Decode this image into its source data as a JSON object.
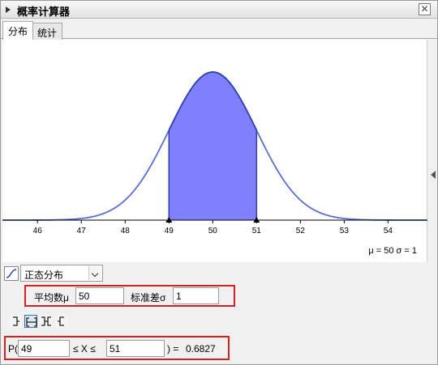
{
  "window": {
    "title": "概率计算器",
    "close_glyph": "✕"
  },
  "tabs": [
    {
      "label": "分布",
      "active": true
    },
    {
      "label": "统计",
      "active": false
    }
  ],
  "chart_data": {
    "type": "area",
    "distribution": "normal",
    "mu": 50,
    "sigma": 1,
    "x_ticks": [
      46,
      47,
      48,
      49,
      50,
      51,
      52,
      53,
      54
    ],
    "xlim": [
      45.2,
      54.9
    ],
    "shaded_range": [
      49,
      51
    ],
    "colors": {
      "curve": "#5a6fd0",
      "fill": "#8080ff",
      "edge": "#3040b0"
    },
    "params_text": "μ = 50    σ = 1"
  },
  "controls": {
    "distribution_select": "正态分布",
    "mean_label": "平均数μ",
    "mean_value": "50",
    "sd_label": "标准差σ",
    "sd_value": "1"
  },
  "probability": {
    "prefix": "P(",
    "lower": "49",
    "middle": "≤ X ≤",
    "upper": "51",
    "suffix": ") =",
    "result": "0.6827"
  }
}
